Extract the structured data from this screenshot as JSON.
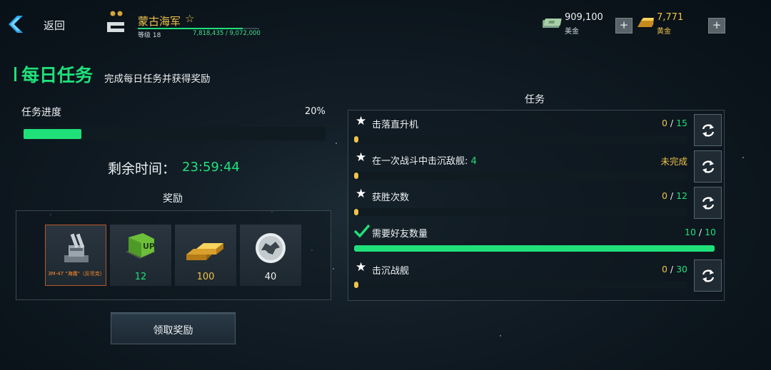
{
  "topbar": {
    "back_label": "返回",
    "player_name": "蒙古海军",
    "level_label": "等级 18",
    "xp_text": "7,818,435 / 9,072,000",
    "xp_progress": 0.862,
    "cash_value": "909,100",
    "cash_label": "美金",
    "gold_value": "7,771",
    "gold_label": "黄金",
    "plus_symbol": "+"
  },
  "header": {
    "title": "每日任务",
    "subtitle": "完成每日任务并获得奖励"
  },
  "progress": {
    "label": "任务进度",
    "percent_text": "20%",
    "percent": 0.2
  },
  "timer": {
    "label": "剩余时间：",
    "value": "23:59:44"
  },
  "rewards": {
    "title": "奖励",
    "items": [
      {
        "name": "3M-47 \"海鹰\"（反坦克）",
        "icon": "turret-icon",
        "qty": ""
      },
      {
        "name": "",
        "icon": "upgrade-kit-icon",
        "qty": "12",
        "qty_color": "#20e07a"
      },
      {
        "name": "",
        "icon": "gold-bars-icon",
        "qty": "100",
        "qty_color": "#f0c24a"
      },
      {
        "name": "",
        "icon": "eagle-emblem-icon",
        "qty": "40",
        "qty_color": "#eef2f4"
      }
    ],
    "claim_label": "领取奖励"
  },
  "tasks": {
    "title": "任务",
    "items": [
      {
        "name": "击落直升机",
        "count_current": "0",
        "count_total": "15",
        "progress": 0,
        "complete": false,
        "refresh": true
      },
      {
        "name": "在一次战斗中击沉敌舰:",
        "name_value": "4",
        "status": "未完成",
        "progress": 0,
        "complete": false,
        "refresh": true
      },
      {
        "name": "获胜次数",
        "count_current": "0",
        "count_total": "12",
        "progress": 0,
        "complete": false,
        "refresh": true
      },
      {
        "name": "需要好友数量",
        "count_current": "10",
        "count_total": "10",
        "progress": 1,
        "complete": true,
        "refresh": false
      },
      {
        "name": "击沉战舰",
        "count_current": "0",
        "count_total": "30",
        "progress": 0,
        "complete": false,
        "refresh": true
      }
    ],
    "separator": " / "
  },
  "colors": {
    "accent_green": "#20e07a",
    "gold": "#f0c24a",
    "orange": "#ff8a2a"
  }
}
